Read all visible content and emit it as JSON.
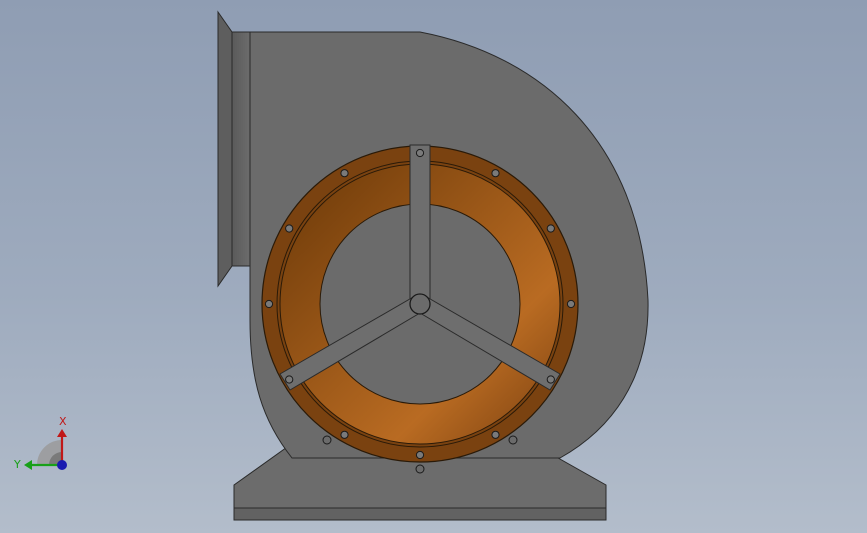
{
  "viewport": {
    "background_top": "#8f9db3",
    "background_bottom": "#b3bdcb"
  },
  "model": {
    "housing_color": "#6b6b6b",
    "housing_edge_color": "#2a2a2a",
    "inlet_ring_color": "#8a4a10",
    "inlet_ring_highlight": "#b86a22",
    "bolt_count": 12
  },
  "triad": {
    "x_label": "X",
    "y_label": "Y",
    "x_color": "#c01818",
    "y_color": "#18a018",
    "z_color": "#1a1ab0"
  }
}
